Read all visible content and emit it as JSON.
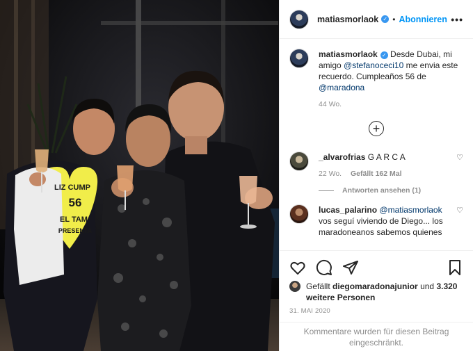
{
  "header": {
    "username": "matiasmorlaok",
    "follow_label": "Abonnieren",
    "separator": "•",
    "more_label": "•••"
  },
  "caption": {
    "username": "matiasmorlaok",
    "text_1": "Desde Dubai, mi amigo ",
    "mention_1": "@stefanoceci10",
    "text_2": " me envia este recuerdo. Cumpleaños 56 de ",
    "mention_2": "@maradona",
    "age": "44 Wo."
  },
  "load_more_label": "+",
  "comments": [
    {
      "username": "_alvarofrias",
      "text": "G A R C A",
      "age": "22 Wo.",
      "likes": "Gefällt 162 Mal",
      "replies_label": "Antworten ansehen (1)"
    },
    {
      "username": "lucas_palarino",
      "mention": "@matiasmorlaok",
      "text": "vos seguí viviendo de Diego... los maradoneanos sabemos quienes"
    }
  ],
  "likes": {
    "prefix": "Gefällt",
    "user": "diegomaradonajunior",
    "conj": "und",
    "count": "3.320 weitere Personen"
  },
  "date": "31. MAI 2020",
  "restricted_notice": "Kommentare wurden für diesen Beitrag eingeschränkt.",
  "shirt_text": {
    "line1": "LIZ CUMP",
    "line2": "56",
    "line3": "EL TAM",
    "line4": "PRESENTA"
  },
  "icons": {
    "verified": "verified-badge-icon",
    "heart": "heart-icon",
    "comment": "comment-icon",
    "share": "paper-plane-icon",
    "save": "bookmark-icon",
    "add": "plus-circle-icon"
  },
  "colors": {
    "accent": "#0095f6",
    "verified": "#3897f0",
    "muted": "#8e8e8e",
    "text": "#262626"
  }
}
